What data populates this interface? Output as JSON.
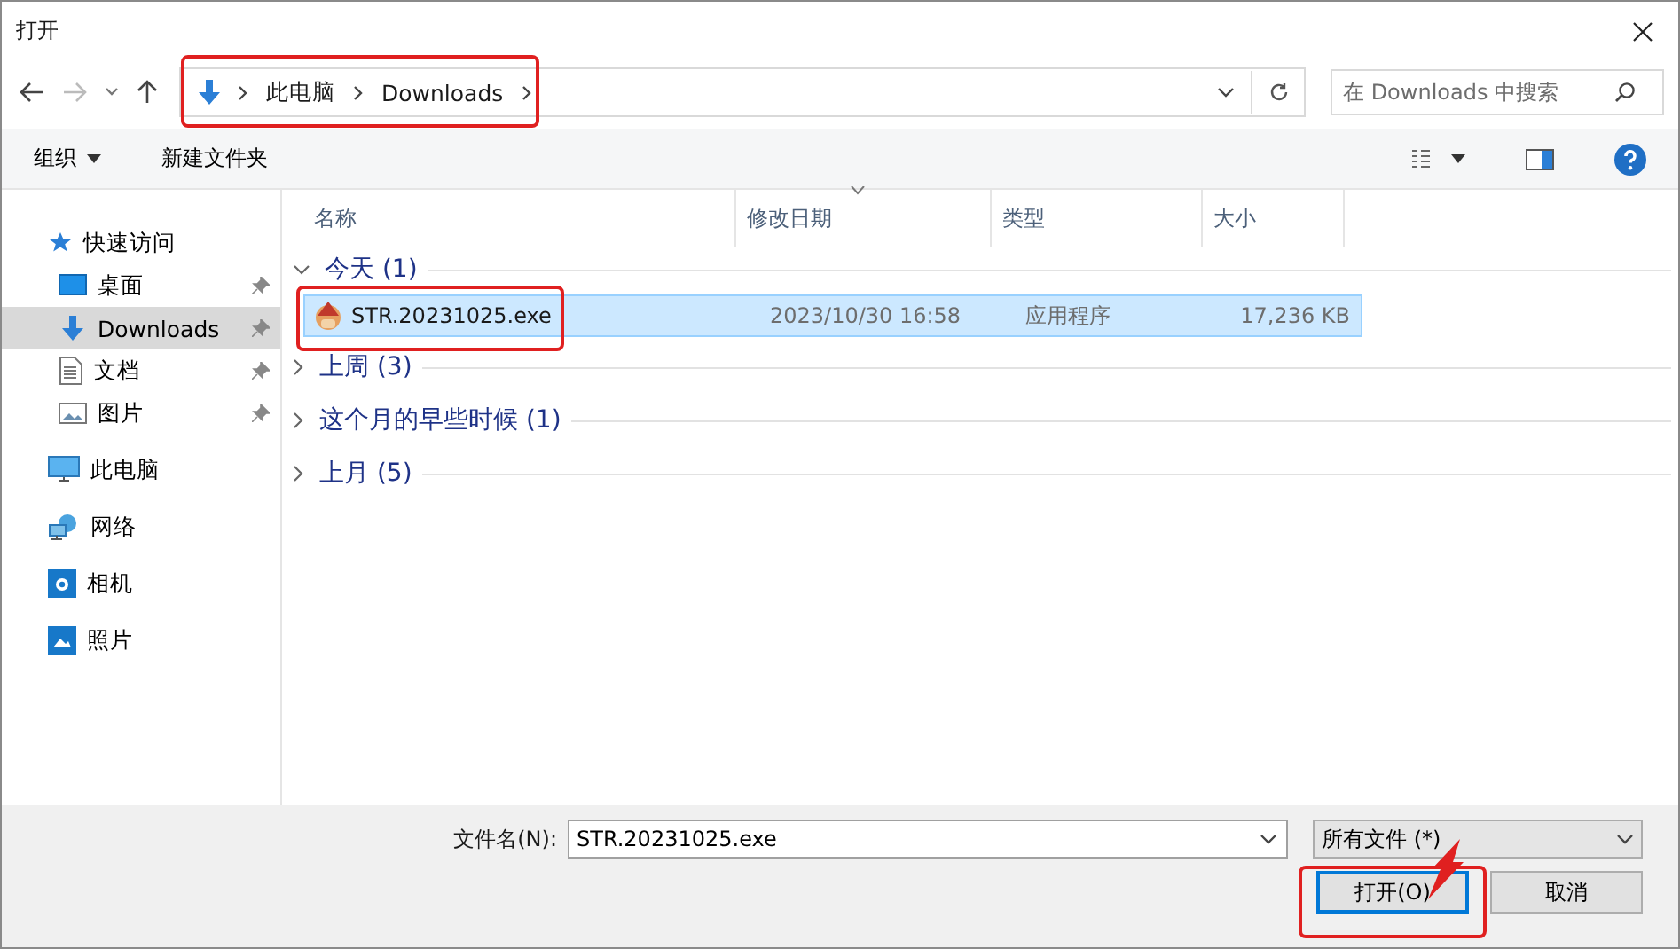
{
  "window": {
    "title": "打开"
  },
  "address": {
    "crumbs": [
      "此电脑",
      "Downloads"
    ]
  },
  "search": {
    "placeholder": "在 Downloads 中搜索"
  },
  "toolbar": {
    "organize": "组织",
    "new_folder": "新建文件夹"
  },
  "sidebar": {
    "items": [
      {
        "label": "快速访问",
        "selected": false,
        "children": [
          {
            "label": "桌面",
            "pinned": true,
            "selected": false
          },
          {
            "label": "Downloads",
            "pinned": true,
            "selected": true
          },
          {
            "label": "文档",
            "pinned": true,
            "selected": false
          },
          {
            "label": "图片",
            "pinned": true,
            "selected": false
          }
        ]
      },
      {
        "label": "此电脑",
        "selected": false
      },
      {
        "label": "网络",
        "selected": false
      },
      {
        "label": "相机",
        "selected": false
      },
      {
        "label": "照片",
        "selected": false
      }
    ]
  },
  "table": {
    "columns": [
      "名称",
      "修改日期",
      "类型",
      "大小"
    ],
    "groups": [
      {
        "label": "今天 (1)",
        "expanded": true,
        "rows": [
          {
            "name": "STR.20231025.exe",
            "date": "2023/10/30 16:58",
            "type": "应用程序",
            "size": "17,236 KB",
            "selected": true
          }
        ]
      },
      {
        "label": "上周 (3)",
        "expanded": false
      },
      {
        "label": "这个月的早些时候 (1)",
        "expanded": false
      },
      {
        "label": "上月 (5)",
        "expanded": false
      }
    ]
  },
  "footer": {
    "filename_label": "文件名(N):",
    "filename": "STR.20231025.exe",
    "filter": "所有文件 (*)",
    "buttons": [
      {
        "label": "打开(O)",
        "kind": "primary"
      },
      {
        "label": "取消",
        "kind": "normal"
      }
    ]
  }
}
